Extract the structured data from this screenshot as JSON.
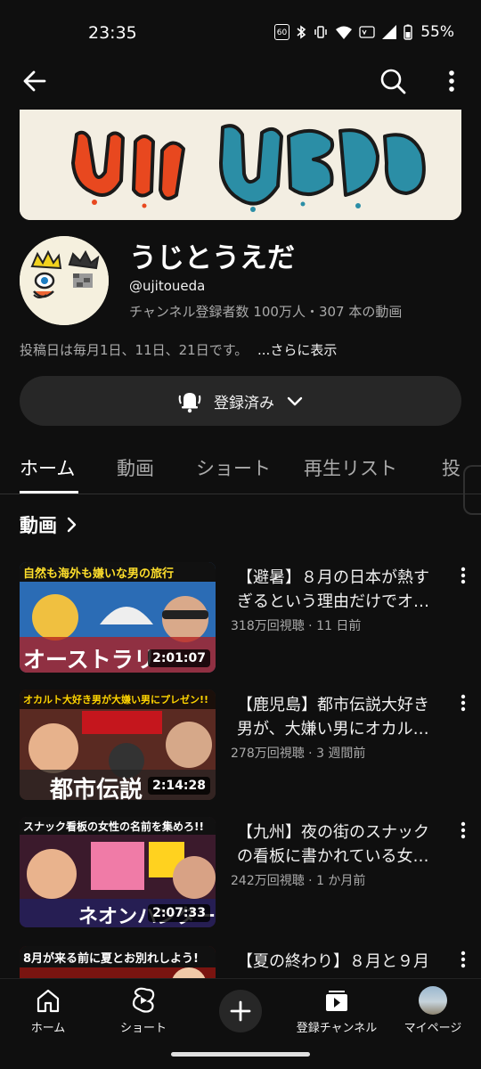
{
  "status_bar": {
    "time": "23:35",
    "badge_label": "60",
    "battery": "55%"
  },
  "channel": {
    "name": "うじとうえだ",
    "handle": "@ujitoueda",
    "stats": "チャンネル登録者数 100万人・307 本の動画",
    "description": "投稿日は毎月1日、11日、21日です。",
    "more_label": "...さらに表示"
  },
  "subscribe": {
    "label": "登録済み"
  },
  "tabs": [
    {
      "label": "ホーム"
    },
    {
      "label": "動画"
    },
    {
      "label": "ショート"
    },
    {
      "label": "再生リスト"
    },
    {
      "label": "投"
    }
  ],
  "section": {
    "title": "動画"
  },
  "videos": [
    {
      "title": "【避暑】８月の日本が熱すぎるという理由だけでオ…",
      "meta": "318万回視聴 · 11 日前",
      "duration": "2:01:07",
      "thumb_caption": "自然も海外も嫌いな男の旅行",
      "thumb_big_text": "オーストラリ",
      "thumb_color": "#2b6cb5"
    },
    {
      "title": "【鹿児島】都市伝説大好き男が、大嫌い男にオカル…",
      "meta": "278万回視聴 · 3 週間前",
      "duration": "2:14:28",
      "thumb_caption": "オカルト大好き男が大嫌い男にプレゼン!!",
      "thumb_big_text": "都市伝説",
      "thumb_color": "#5a2a22"
    },
    {
      "title": "【九州】夜の街のスナックの看板に書かれている女…",
      "meta": "242万回視聴 · 1 か月前",
      "duration": "2:07:33",
      "thumb_caption": "スナック看板の女性の名前を集めろ!!",
      "thumb_big_text": "ネオンハンター",
      "thumb_color": "#3b1a2c"
    },
    {
      "title": "【夏の終わり】８月と９月",
      "meta": "",
      "duration": "",
      "thumb_caption": "8月が来る前に夏とお別れしよう!",
      "thumb_big_text": "",
      "thumb_color": "#7a1410"
    }
  ],
  "bottom_nav": [
    {
      "label": "ホーム",
      "icon": "home-icon"
    },
    {
      "label": "ショート",
      "icon": "shorts-icon"
    },
    {
      "label": "",
      "icon": "plus-icon"
    },
    {
      "label": "登録チャンネル",
      "icon": "subscriptions-icon"
    },
    {
      "label": "マイページ",
      "icon": "avatar"
    }
  ]
}
